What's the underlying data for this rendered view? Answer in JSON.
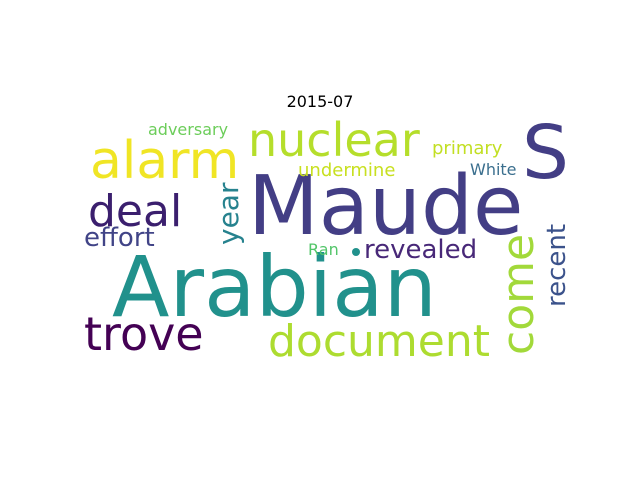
{
  "title": "2015-07",
  "words": [
    {
      "text": "Maude",
      "color": "#433e85"
    },
    {
      "text": "Arabian",
      "color": "#21918c"
    },
    {
      "text": "S",
      "color": "#433e85"
    },
    {
      "text": "alarm",
      "color": "#f0e525"
    },
    {
      "text": "nuclear",
      "color": "#b5de2b"
    },
    {
      "text": "document",
      "color": "#addc30"
    },
    {
      "text": "trove",
      "color": "#440154"
    },
    {
      "text": "deal",
      "color": "#3b1f6e"
    },
    {
      "text": "come",
      "color": "#a2d93a"
    },
    {
      "text": "effort",
      "color": "#414487"
    },
    {
      "text": "revealed",
      "color": "#482878"
    },
    {
      "text": "recent",
      "color": "#3b528b"
    },
    {
      "text": "year",
      "color": "#26828e"
    },
    {
      "text": "undermine",
      "color": "#c8e020"
    },
    {
      "text": "primary",
      "color": "#c2df23"
    },
    {
      "text": "adversary",
      "color": "#6ccd5a"
    },
    {
      "text": "White",
      "color": "#3b6f8e"
    },
    {
      "text": "Ran",
      "color": "#52c569"
    }
  ]
}
